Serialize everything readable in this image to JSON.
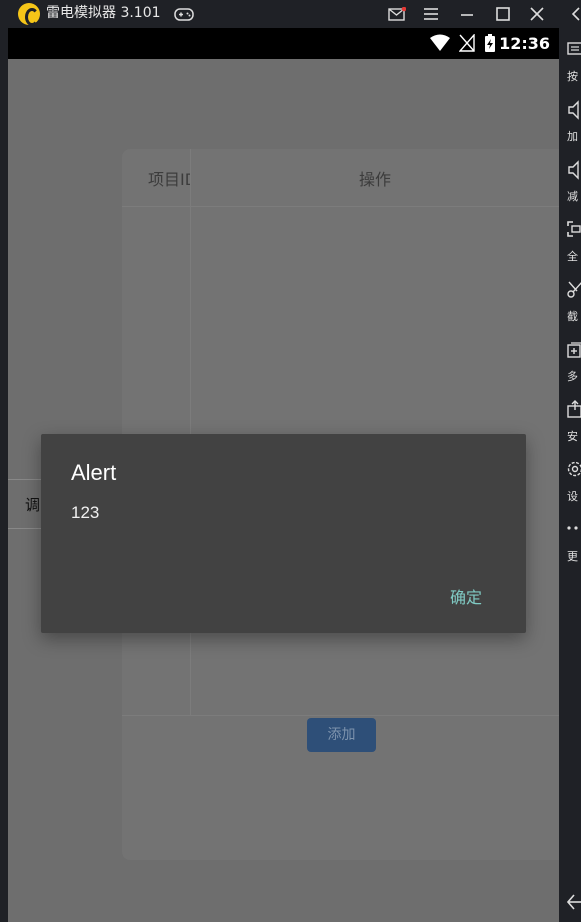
{
  "titlebar": {
    "app_title": "雷电模拟器 3.101"
  },
  "statusbar": {
    "time": "12:36"
  },
  "table": {
    "col_id": "项目ID",
    "col_ops": "操作"
  },
  "side_button": {
    "label": "调"
  },
  "add_button": {
    "label": "添加"
  },
  "dialog": {
    "title": "Alert",
    "message": "123",
    "ok_label": "确定",
    "ok_color": "#80cbc4"
  },
  "sidebar": {
    "items": [
      {
        "label": "按",
        "icon": "keyboard-icon"
      },
      {
        "label": "加",
        "icon": "volume-up-icon"
      },
      {
        "label": "减",
        "icon": "volume-down-icon"
      },
      {
        "label": "全",
        "icon": "fullscreen-icon"
      },
      {
        "label": "截",
        "icon": "scissors-icon"
      },
      {
        "label": "多",
        "icon": "multi-instance-icon"
      },
      {
        "label": "安",
        "icon": "install-apk-icon"
      },
      {
        "label": "设",
        "icon": "settings-icon"
      },
      {
        "label": "更",
        "icon": "more-icon"
      }
    ]
  },
  "colors": {
    "accent_logo": "#f5c518",
    "add_button_bg": "#2e4f78"
  }
}
